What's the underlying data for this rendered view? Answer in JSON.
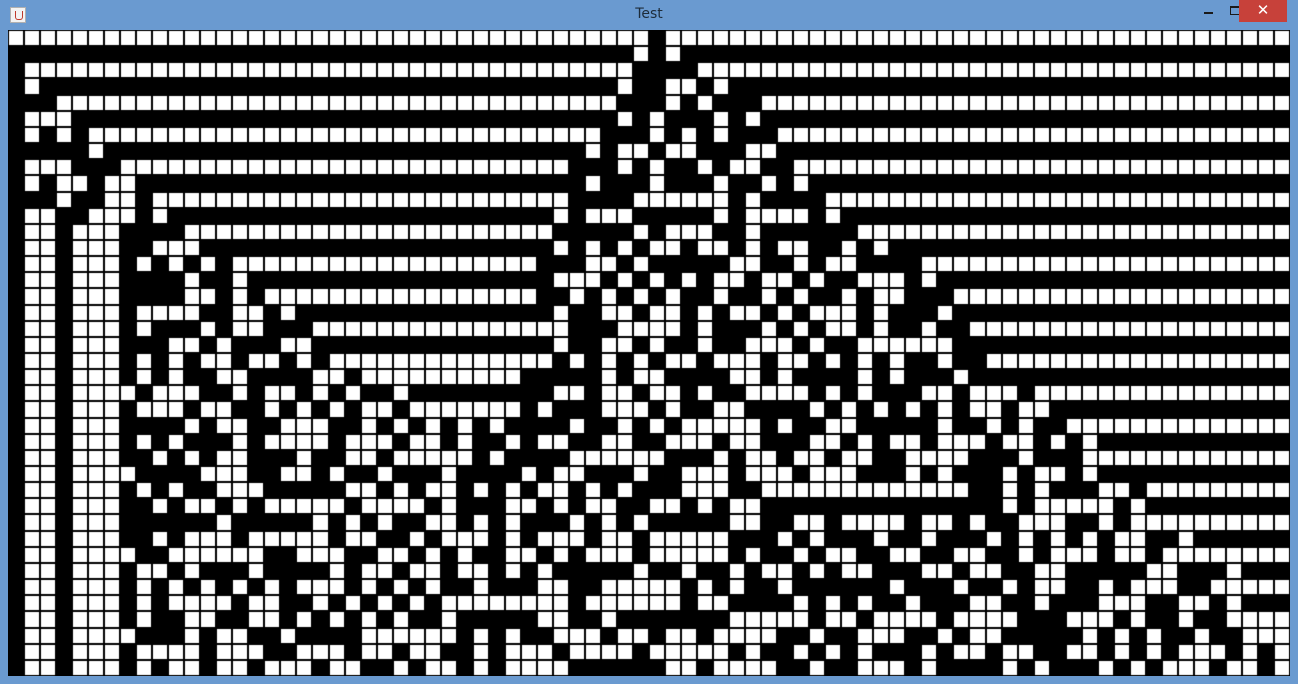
{
  "window": {
    "title": "Test",
    "controls": {
      "close_glyph": "✕"
    },
    "icons": {
      "app": "java-cup-icon",
      "minimize": "minimize-icon",
      "maximize": "maximize-icon",
      "close": "close-icon"
    },
    "colors": {
      "frame": "#6a9ad0",
      "close": "#c7413a"
    }
  },
  "grid": {
    "columns": 80,
    "rows": 40,
    "colors": {
      "filled": "#ffffff",
      "empty": "#000000",
      "cell_border": "#000000"
    },
    "pattern": [
      "11111111111111111111111111111111111111110111111111111111111111111111111111111111",
      "00000000000000000000000000000000000000010100000000000000000000000000000000000000",
      "01111111111111111111111111111111111111100001111111111111111111111111111111111111",
      "01000000000000000000000000000000000000100110100000000000000000000000000000000000",
      "00011111111111111111111111111111111111000101000111111111111111111111111111111111",
      "01110000000000000000000000000000000000101000101000000000000000000000000000000000",
      "01010111111111111111111111111111111110001010100011111111111111111111111111111111",
      "00000100000000000000000000000000000010110110001100000000000000000000000000000000",
      "01110001111111111111111111111111111000101001011001111111111111111111111111111111",
      "01011011000000000000000000000000000010001000100101000000000000000000000000000000",
      "00010011011111111111111111111111111000011111101000011111111111111111111111111111",
      "01100111010000000000000000000000001011100000101111010000000000000000000000000000",
      "01101110000111111111111111111111110000010111001000000111111111111111111111111111",
      "01101110011100000000000000000000001010101101101011001010000000000000000000000000",
      "01101110101010111111111111111111100011010000011001011000011111111111111111111111",
      "01101110000100100000000000000000001110101010110110100111010000000000000000000000",
      "01101110000110101111111111111111100101010100100101001011000111111111111111111111",
      "01101110111100110100000000000000001001101101011010111010001000000000000000000000",
      "01101110100010110001111111111111111000111101000101011010010011111111111111111111",
      "01101110001101000110000000000000001001101001001110100111111000000000000000000000",
      "01101110101011011010111111111111110101010110111011010101001001111111111111111111",
      "01101110101001100001101111111111000001011000011010000101000100000000000000000000",
      "01101111011100101101010010000000001101101101001111010100011011101111111111111111",
      "01101110111011001010101101111111010001110100110000101010101011011000000000000000",
      "01101110000101100111001010101010000100101011111010011000001001010011111111111111",
      "01101110101000101111011101101001011001100111011000110101101110110101000000000000",
      "01101110010101100010011011111010000111111000101101101100111100010001111111111111",
      "01101111000011100110100100010000101100010011101110111000101000101101000000000000",
      "01101110101001110000011010110101011010100011100111111111111100101000110111111111",
      "01101110010110101111101111010001101011001101011000000000000000101111101000000000",
      "01101110000001000001010100110101000101010000011001101111011010011100101111111111",
      "01101110010111011111011001011101011101101111100010100010010001010101011001000000",
      "01101111001111110011100110101001101011101111101001011001100110010111011011111111",
      "01101110110100010000101101101101010000010010010110101100011011001100000110001000",
      "01101110101010101011101010100100011001111101010010000001000100101100101110011111",
      "01101110101111011001010101011111111011111101100001010100100011001000111001101000",
      "01101110100110011010101010010000011001000000011111011011110111100011101001001111",
      "01101111000101100100001111110101001110110110111100100111001011000001010100100111",
      "01101110111101110011101101100101110111101111101001010100010110110011010101110101",
      "01101110101101101110110010110101111000000110111100100111010000101000101011101101"
    ]
  }
}
